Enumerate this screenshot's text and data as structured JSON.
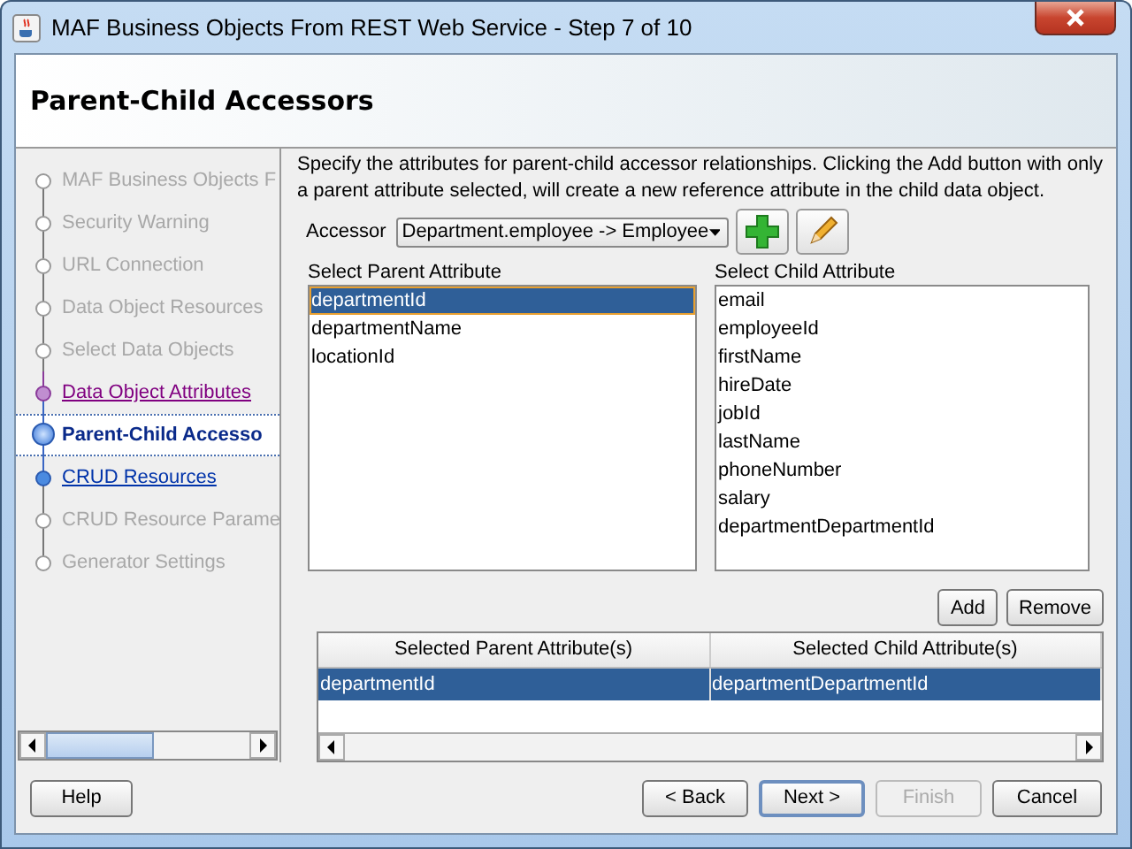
{
  "window": {
    "title": "MAF Business Objects From REST Web Service - Step 7 of 10"
  },
  "header": {
    "title": "Parent-Child Accessors"
  },
  "steps": [
    {
      "label": "MAF Business Objects F",
      "kind": "disabled"
    },
    {
      "label": "Security Warning",
      "kind": "disabled"
    },
    {
      "label": "URL Connection",
      "kind": "disabled"
    },
    {
      "label": "Data Object Resources",
      "kind": "disabled"
    },
    {
      "label": "Select Data Objects",
      "kind": "disabled"
    },
    {
      "label": "Data Object Attributes",
      "kind": "visited"
    },
    {
      "label": "Parent-Child Accesso",
      "kind": "current"
    },
    {
      "label": "CRUD Resources",
      "kind": "link"
    },
    {
      "label": "CRUD Resource Parame",
      "kind": "disabled"
    },
    {
      "label": "Generator Settings",
      "kind": "disabled"
    }
  ],
  "description": "Specify the attributes for parent-child accessor relationships. Clicking the Add button with only a parent attribute selected, will create a new reference attribute in the child data object.",
  "accessor": {
    "label": "Accessor",
    "value": "Department.employee -> Employee"
  },
  "parent_list": {
    "label": "Select Parent Attribute",
    "items": [
      {
        "text": "departmentId",
        "selected": true
      },
      {
        "text": "departmentName",
        "selected": false
      },
      {
        "text": "locationId",
        "selected": false
      }
    ]
  },
  "child_list": {
    "label": "Select Child Attribute",
    "items": [
      {
        "text": "email",
        "selected": false
      },
      {
        "text": "employeeId",
        "selected": false
      },
      {
        "text": "firstName",
        "selected": false
      },
      {
        "text": "hireDate",
        "selected": false
      },
      {
        "text": "jobId",
        "selected": false
      },
      {
        "text": "lastName",
        "selected": false
      },
      {
        "text": "phoneNumber",
        "selected": false
      },
      {
        "text": "salary",
        "selected": false
      },
      {
        "text": "departmentDepartmentId",
        "selected": false
      }
    ]
  },
  "list_buttons": [
    "Add",
    "Remove"
  ],
  "table": {
    "columns": [
      "Selected Parent Attribute(s)",
      "Selected Child Attribute(s)"
    ],
    "rows": [
      {
        "cells": [
          "departmentId",
          "departmentDepartmentId"
        ],
        "selected": true
      }
    ]
  },
  "footer": {
    "help": "Help",
    "buttons": [
      {
        "label": "< Back",
        "disabled": false,
        "default": false
      },
      {
        "label": "Next >",
        "disabled": false,
        "default": true
      },
      {
        "label": "Finish",
        "disabled": true,
        "default": false
      },
      {
        "label": "Cancel",
        "disabled": false,
        "default": false
      }
    ]
  }
}
